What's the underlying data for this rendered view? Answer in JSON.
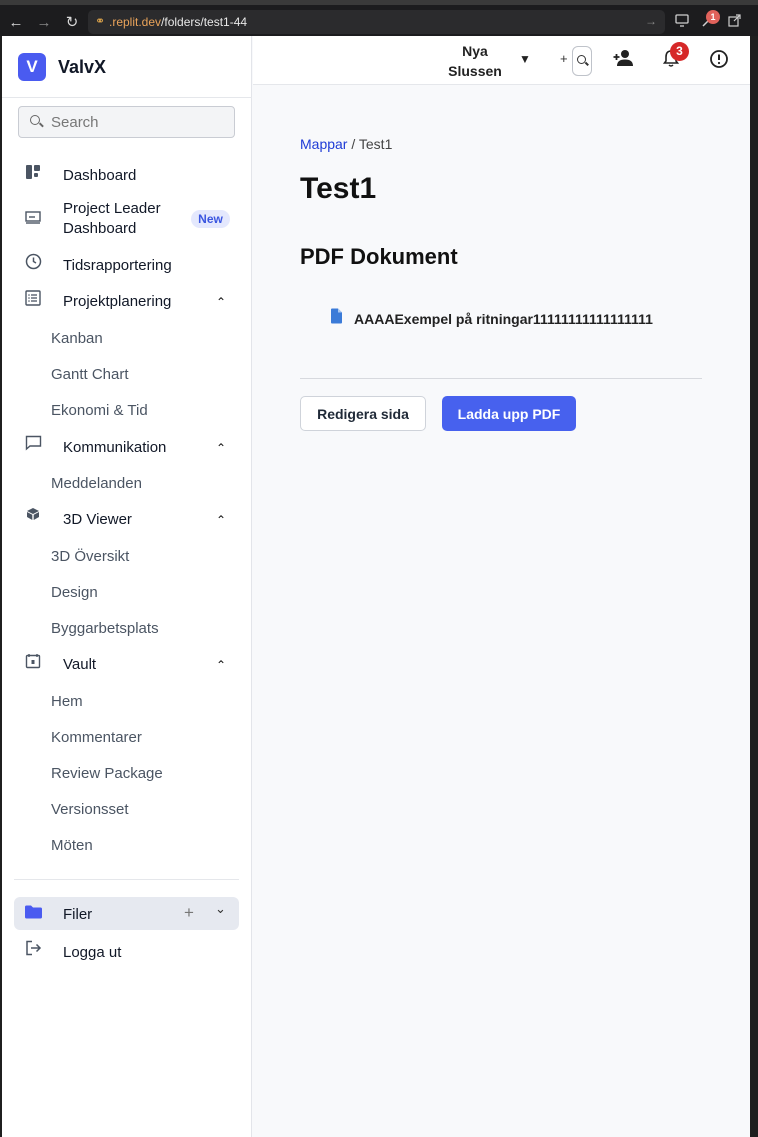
{
  "browser": {
    "url_host": ".replit.dev",
    "url_path": "/folders/test1-44",
    "extension_badge": "1"
  },
  "sidebar": {
    "logo_letter": "V",
    "app_name": "ValvX",
    "search_placeholder": "Search",
    "items": {
      "dashboard": "Dashboard",
      "project_leader_line1": "Project Leader",
      "project_leader_line2": "Dashboard",
      "new_badge": "New",
      "tidsrapportering": "Tidsrapportering",
      "projektplanering": "Projektplanering",
      "kanban": "Kanban",
      "gantt": "Gantt Chart",
      "ekonomi": "Ekonomi & Tid",
      "kommunikation": "Kommunikation",
      "meddelanden": "Meddelanden",
      "viewer3d": "3D Viewer",
      "oversikt3d": "3D Översikt",
      "design": "Design",
      "byggarbetsplats": "Byggarbetsplats",
      "vault": "Vault",
      "hem": "Hem",
      "kommentarer": "Kommentarer",
      "review_package": "Review Package",
      "versionsset": "Versionsset",
      "moten": "Möten",
      "filer": "Filer",
      "logga_ut": "Logga ut"
    }
  },
  "topbar": {
    "project_line1": "Nya",
    "project_line2": "Slussen",
    "plus": "+",
    "notification_count": "3"
  },
  "main": {
    "breadcrumb_link": "Mappar",
    "breadcrumb_sep": " / ",
    "breadcrumb_current": "Test1",
    "title": "Test1",
    "section_title": "PDF Dokument",
    "document_name": "AAAAExempel på ritningar11111111111111111",
    "edit_button": "Redigera sida",
    "upload_button": "Ladda upp PDF"
  },
  "colors": {
    "accent": "#4761ee",
    "link": "#1e3bd6",
    "badge_red": "#d62828"
  }
}
